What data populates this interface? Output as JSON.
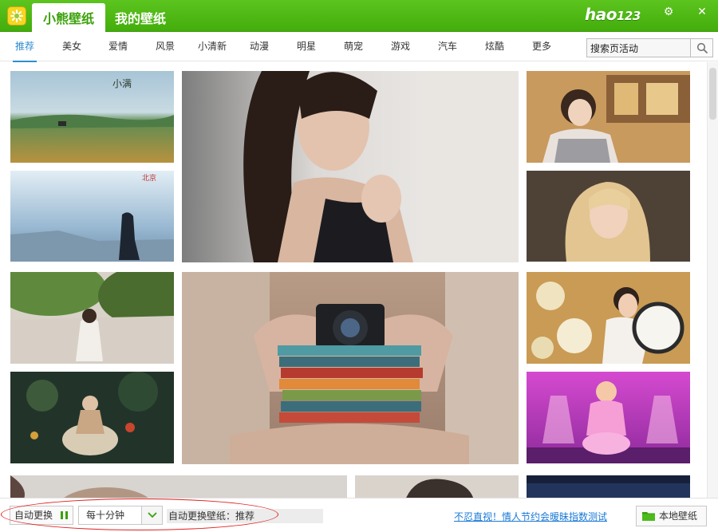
{
  "titlebar": {
    "tab_main": "小熊壁纸",
    "tab_mine": "我的壁纸",
    "brand_hao": "hao",
    "brand_num": "123",
    "settings_glyph": "⚙",
    "close_glyph": "✕"
  },
  "nav": {
    "items": [
      "推荐",
      "美女",
      "爱情",
      "风景",
      "小清新",
      "动漫",
      "明星",
      "萌宠",
      "游戏",
      "汽车",
      "炫酷",
      "更多"
    ],
    "active_index": 0
  },
  "search": {
    "value": "搜索页活动"
  },
  "gallery": {
    "tiles": [
      {
        "subject": "grassland with calligraphy 小满",
        "caption": "小满",
        "colors": [
          "#9dbbd0",
          "#6f9a55",
          "#c9a03f"
        ]
      },
      {
        "subject": "person on cliff by sea at dusk",
        "caption": "",
        "colors": [
          "#d7e8f2",
          "#84a9c7",
          "#2b3b4a"
        ]
      },
      {
        "subject": "girl in white dress in park",
        "caption": "",
        "colors": [
          "#7d9a5d",
          "#d9d0c5",
          "#4a5c35"
        ]
      },
      {
        "subject": "fairy girl in flower forest",
        "caption": "",
        "colors": [
          "#2a3b2d",
          "#c9b79d",
          "#7a3d2b"
        ]
      },
      {
        "subject": "woman in car seat portrait",
        "caption": "",
        "colors": [
          "#e9e6e3",
          "#cdb3a3",
          "#2b2523"
        ]
      },
      {
        "subject": "girl holding camera over books",
        "caption": "",
        "colors": [
          "#c6aa98",
          "#4c4f58",
          "#8a6b5b"
        ]
      },
      {
        "subject": "girl in cafe with plaid shirt",
        "caption": "",
        "colors": [
          "#d6b07a",
          "#7f5a3a",
          "#3a2c24"
        ]
      },
      {
        "subject": "blonde woman portrait",
        "caption": "",
        "colors": [
          "#5a4a3a",
          "#e3c48f",
          "#3a302a"
        ]
      },
      {
        "subject": "girl holding white hat with flowers",
        "caption": "",
        "colors": [
          "#d8b46d",
          "#f2ede4",
          "#8a5a2b"
        ]
      },
      {
        "subject": "girl in pink on purple stage",
        "caption": "",
        "colors": [
          "#c13bc9",
          "#f1a6d8",
          "#6a2380"
        ]
      },
      {
        "subject": "partial bottom row tile 1",
        "caption": "",
        "colors": [
          "#d5d2cf",
          "#6a5148",
          "#b99b8a"
        ]
      },
      {
        "subject": "partial bottom row tile 2",
        "caption": "",
        "colors": [
          "#dcd6d0",
          "#3a302c",
          "#b6a293"
        ]
      },
      {
        "subject": "partial bottom row tile 3",
        "caption": "",
        "colors": [
          "#1e2a4a",
          "#3c5a8c",
          "#0f1628"
        ]
      }
    ]
  },
  "bottombar": {
    "auto_change_label": "自动更换",
    "interval_value": "每十分钟",
    "status_text": "自动更换壁纸：推荐",
    "promo_link": "不忍直视！情人节约会暧昧指数测试",
    "local_wallpaper_label": "本地壁纸"
  },
  "colors": {
    "brand_green": "#43ad0c",
    "nav_active": "#2f8ccf",
    "link_blue": "#1a79d6",
    "highlight_red": "#e02020"
  }
}
